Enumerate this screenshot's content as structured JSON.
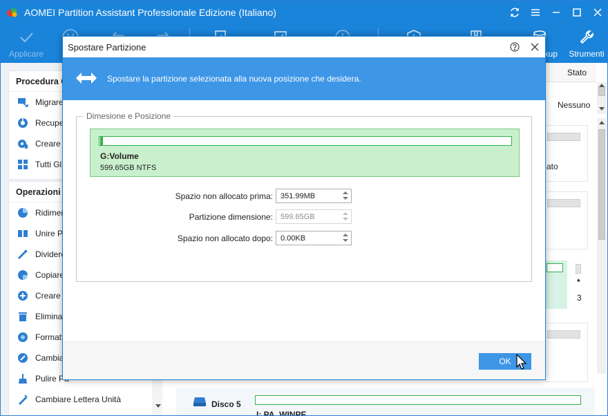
{
  "window": {
    "title": "AOMEI Partition Assistant Professionale Edizione (Italiano)"
  },
  "toolbar": {
    "apply_label": "Applicare",
    "backup_label": "kup",
    "tools_label": "Strumenti"
  },
  "sidebar": {
    "wizard_section": {
      "title": "Procedura G",
      "items": [
        {
          "label": "Migrare",
          "icon": "migrate-os-icon"
        },
        {
          "label": "Recuper",
          "icon": "recover-icon"
        },
        {
          "label": "Creare M",
          "icon": "bootable-media-icon"
        },
        {
          "label": "Tutti Gli S",
          "icon": "all-tools-icon"
        }
      ]
    },
    "operations_section": {
      "title": "Operazioni d",
      "items": [
        {
          "label": "Ridimens",
          "icon": "resize-icon"
        },
        {
          "label": "Unire Pa",
          "icon": "merge-icon"
        },
        {
          "label": "Dividere",
          "icon": "split-icon"
        },
        {
          "label": "Copiare",
          "icon": "copy-icon"
        },
        {
          "label": "Creare P",
          "icon": "create-partition-icon"
        },
        {
          "label": "Eliminare",
          "icon": "delete-icon"
        },
        {
          "label": "Formatta",
          "icon": "format-icon"
        },
        {
          "label": "Cambiare",
          "icon": "change-icon"
        },
        {
          "label": "Pulire Pa",
          "icon": "wipe-icon"
        },
        {
          "label": "Cambiare Lettera Unità",
          "icon": "change-letter-icon"
        }
      ]
    }
  },
  "background": {
    "column_status": "Stato",
    "row_status_value": "Nessuno",
    "partial_text": "ato",
    "star": "*",
    "three": "3",
    "disk_name": "Disco 5",
    "disk_partition": "I: PA_WINPE"
  },
  "dialog": {
    "title": "Spostare Partizione",
    "banner_text": "Spostare la partizione selezionata alla nuova posizione che desidera.",
    "group_title": "Dimesione e Posizione",
    "partition": {
      "name": "G:Volume",
      "info": "599.65GB NTFS",
      "offset_fraction": 0.0006,
      "size_fraction": 0.9994
    },
    "fields": {
      "before": {
        "label": "Spazio non allocato prima:",
        "value": "351.99MB"
      },
      "size": {
        "label": "Partizione dimensione:",
        "value": "599.65GB"
      },
      "after": {
        "label": "Spazio non allocato dopo:",
        "value": "0.00KB"
      }
    },
    "ok_label": "OK"
  },
  "colors": {
    "titlebar": "#1a84db",
    "banner": "#3e96e6",
    "partition_green": "#35b04a",
    "partition_bg": "#c9f0cc"
  }
}
